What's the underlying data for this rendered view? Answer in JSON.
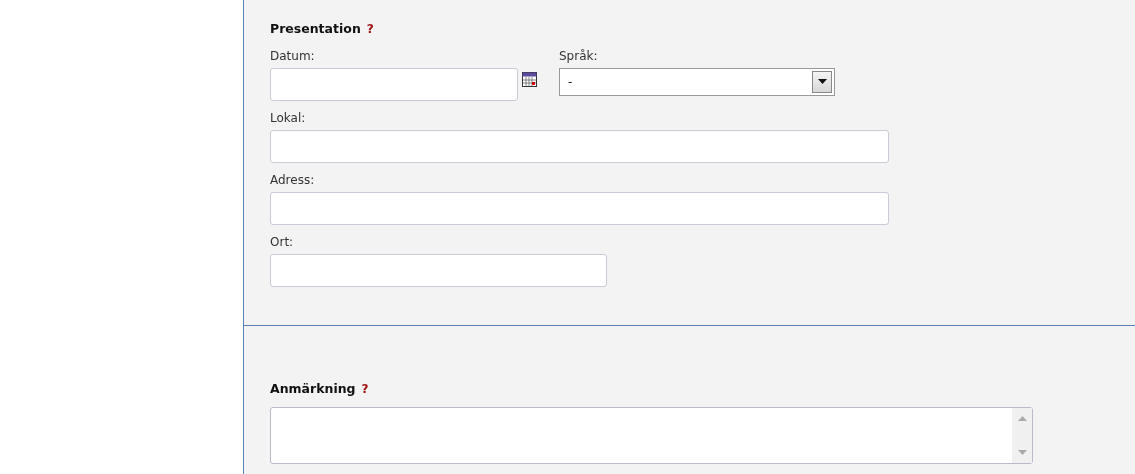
{
  "sections": [
    {
      "title": "Presentation",
      "help": "?",
      "fields": [
        {
          "kind": "date",
          "label": "Datum:"
        },
        {
          "kind": "select",
          "label": "Språk:",
          "value": "-"
        },
        {
          "kind": "text",
          "label": "Lokal:"
        },
        {
          "kind": "text",
          "label": "Adress:"
        },
        {
          "kind": "short-text",
          "label": "Ort:"
        }
      ]
    },
    {
      "title": "Anmärkning",
      "help": "?",
      "fields": [
        {
          "kind": "textarea"
        }
      ]
    }
  ]
}
